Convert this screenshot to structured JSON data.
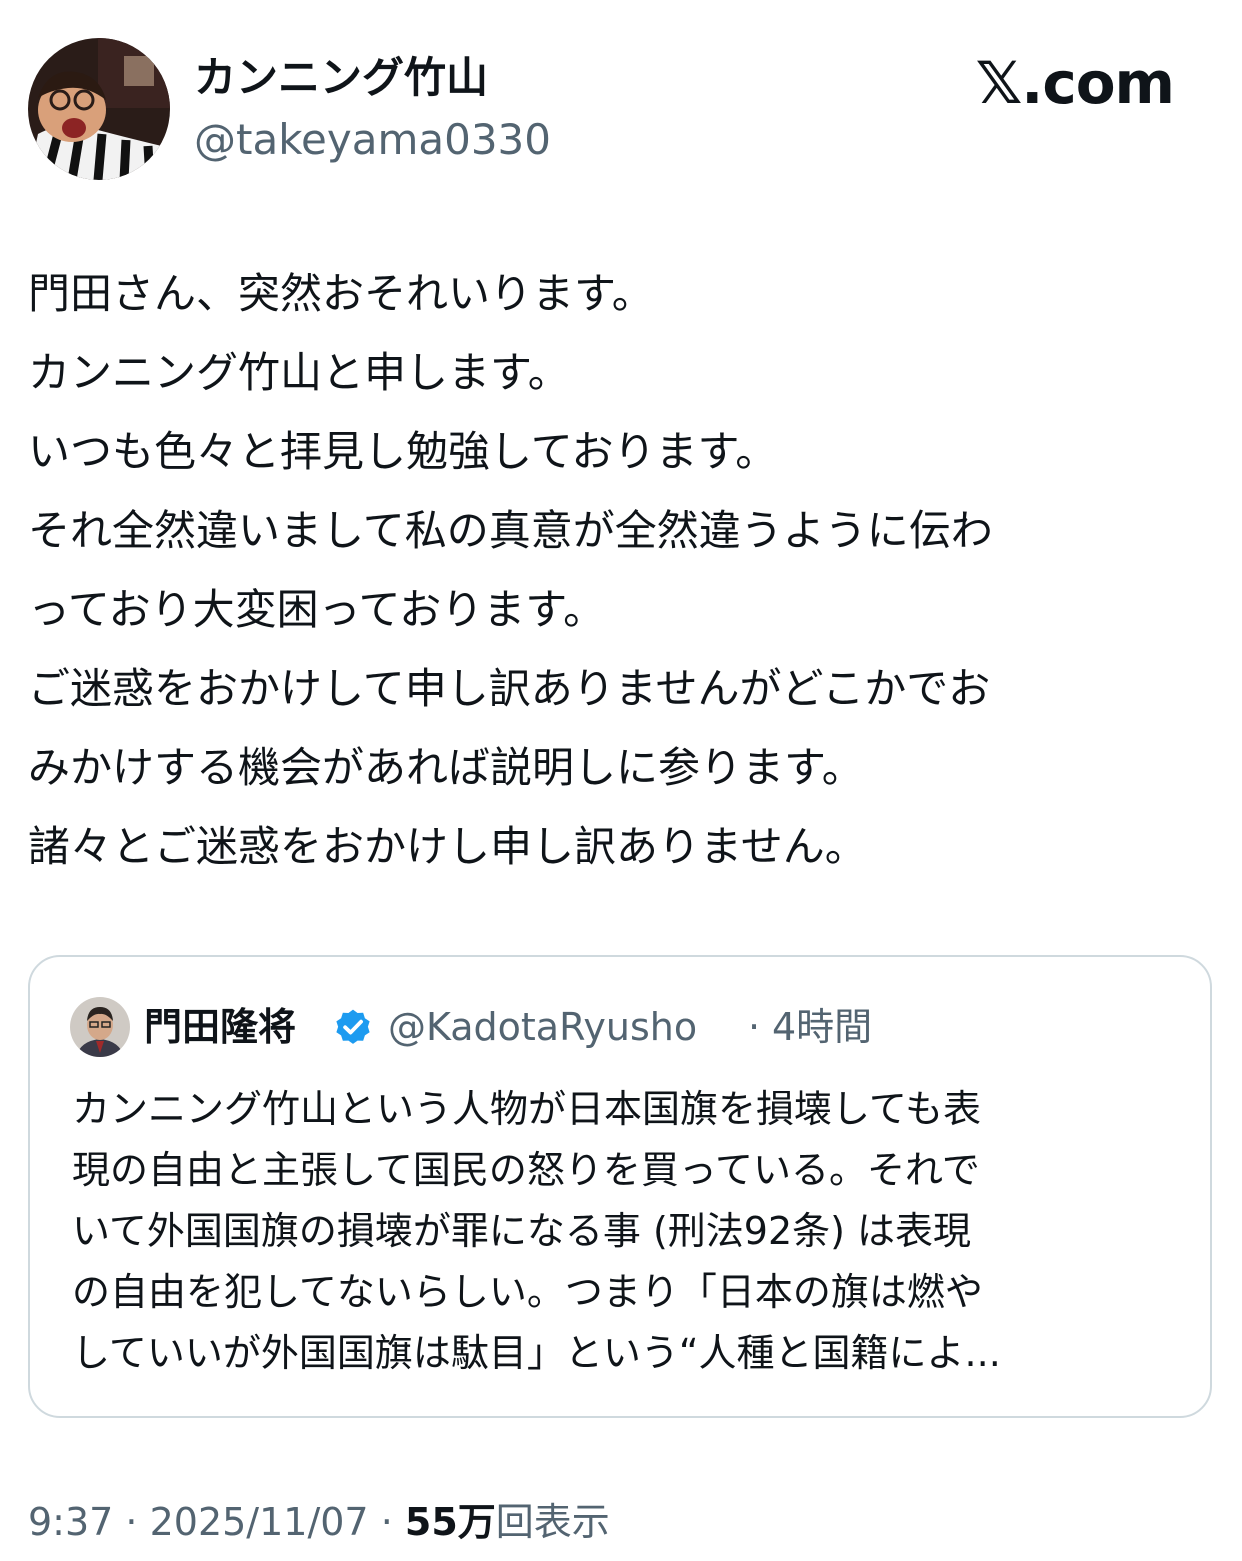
{
  "author": {
    "name": "カンニング竹山",
    "handle": "@takeyama0330"
  },
  "brand": "𝕏.com",
  "tweet": {
    "lines": [
      "門田さん、突然おそれいります。",
      "カンニング竹山と申します。",
      "いつも色々と拝見し勉強しております。",
      "それ全然違いまして私の真意が全然違うように伝わ",
      "っており大変困っております。",
      "ご迷惑をおかけして申し訳ありませんがどこかでお",
      "みかけする機会があれば説明しに参ります。",
      "諸々とご迷惑をおかけし申し訳ありません。"
    ]
  },
  "quote": {
    "name": "門田隆将",
    "handle": "@KadotaRyusho",
    "separator": "·",
    "time": "4時間",
    "verified_icon": "verified-badge-icon",
    "verified_color": "#1d9bf0",
    "lines": [
      "カンニング竹山という人物が日本国旗を損壊しても表",
      "現の自由と主張して国民の怒りを買っている。それで",
      "いて外国国旗の損壊が罪になる事 (刑法92条) は表現",
      "の自由を犯してないらしい。つまり「日本の旗は燃や",
      "していいが外国国旗は駄目」という“人種と国籍によ..."
    ]
  },
  "meta": {
    "time": "9:37",
    "sep1": " · ",
    "date": "2025/11/07",
    "sep2": " · ",
    "views_count": "55万",
    "views_label": "回表示"
  },
  "colors": {
    "text": "#0f1419",
    "secondary": "#536471",
    "border": "#cfd9de"
  }
}
